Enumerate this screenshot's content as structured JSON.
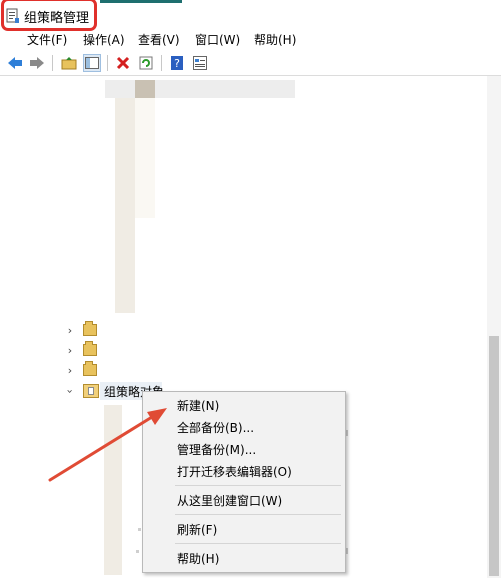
{
  "window": {
    "title": "组策略管理"
  },
  "menu": [
    "文件(F)",
    "操作(A)",
    "查看(V)",
    "窗口(W)",
    "帮助(H)"
  ],
  "toolbar": [
    "back-icon",
    "forward-icon",
    "up-folder-icon",
    "show-tree-icon",
    "delete-icon",
    "refresh-icon",
    "help-icon",
    "properties-icon"
  ],
  "tree": {
    "selected_label": "组策略对象"
  },
  "context_menu": {
    "items": [
      "新建(N)",
      "全部备份(B)...",
      "管理备份(M)...",
      "打开迁移表编辑器(O)",
      "从这里创建窗口(W)",
      "刷新(F)",
      "帮助(H)"
    ]
  },
  "colors": {
    "highlight_border": "#e0302b",
    "arrow": "#e04b35",
    "folder": "#e8c25d",
    "selection": "#eaf0f6"
  }
}
